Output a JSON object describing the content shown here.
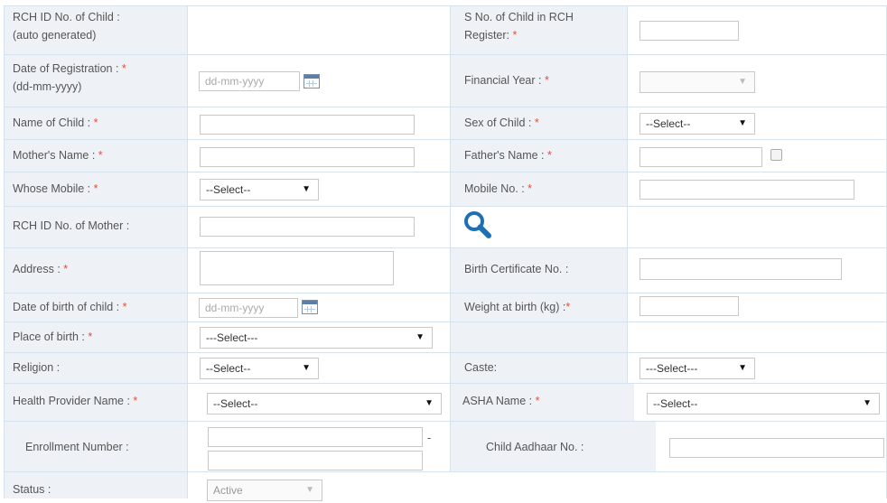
{
  "form": {
    "rows": [
      {
        "left_label": "RCH ID No. of Child :",
        "left_label2": "(auto generated)",
        "right_label": "S No. of Child in RCH",
        "right_label2": "Register: "
      },
      {
        "left_label": "Date of Registration : ",
        "left_label2": "(dd-mm-yyyy)",
        "right_label": "Financial Year : "
      },
      {
        "left_label": "Name of Child : ",
        "right_label": "Sex of Child : "
      },
      {
        "left_label": "Mother's Name : ",
        "right_label": "Father's Name : "
      },
      {
        "left_label": "Whose Mobile : ",
        "right_label": "Mobile No. : "
      },
      {
        "left_label": "RCH ID No. of Mother :"
      },
      {
        "left_label": "Address : ",
        "right_label": "Birth Certificate No. :"
      },
      {
        "left_label": "Date of birth of child : ",
        "right_label": "Weight at birth (kg) :"
      },
      {
        "left_label": "Place of birth : "
      },
      {
        "left_label": "Religion :",
        "right_label": "Caste:"
      },
      {
        "left_label": "Health Provider Name : ",
        "right_label": "ASHA Name : "
      },
      {
        "left_label": "Enrollment Number :",
        "right_label": "Child Aadhaar No. :"
      },
      {
        "left_label": "Status :"
      }
    ],
    "required_mark": "*",
    "date_placeholder": "dd-mm-yyyy",
    "selects": {
      "sex": "--Select--",
      "whose_mobile": "--Select--",
      "place_of_birth": "---Select---",
      "religion": "--Select--",
      "caste": "---Select---",
      "health_provider": "--Select--",
      "asha": "--Select--",
      "status": "Active"
    },
    "enrollment_separator": "-",
    "arrow_glyph": "▼"
  },
  "colors": {
    "label_bg": "#eef2f7",
    "required": "#e74c3c",
    "border": "#d6e3ef",
    "search_icon": "#1f6fb5"
  }
}
